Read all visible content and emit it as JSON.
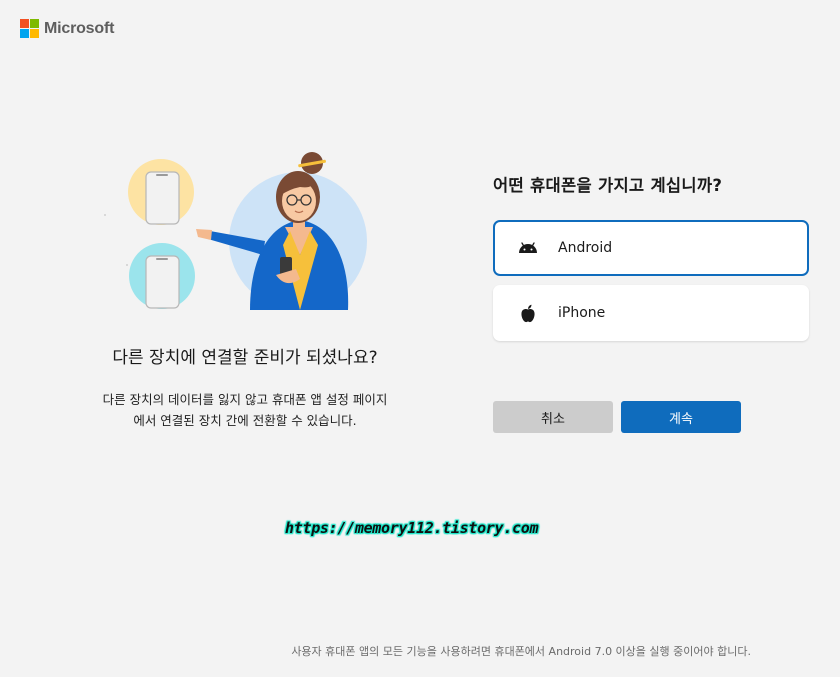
{
  "brand": {
    "name": "Microsoft",
    "colors": [
      "#f25022",
      "#7fba00",
      "#00a4ef",
      "#ffb900"
    ]
  },
  "left": {
    "title": "다른 장치에 연결할 준비가 되셨나요?",
    "description_line1": "다른 장치의 데이터를 잃지 않고 휴대폰 앱 설정 페이지",
    "description_line2": "에서 연결된 장치 간에 전환할 수 있습니다."
  },
  "question": "어떤 휴대폰을 가지고 계십니까?",
  "options": [
    {
      "label": "Android",
      "icon": "android-icon",
      "selected": true
    },
    {
      "label": "iPhone",
      "icon": "apple-icon",
      "selected": false
    }
  ],
  "buttons": {
    "cancel": "취소",
    "continue": "계속"
  },
  "watermark": "https://memory112.tistory.com",
  "footer": "사용자 휴대폰 앱의 모든 기능을 사용하려면 휴대폰에서 Android 7.0 이상을 실행 중이어야 합니다.",
  "colors": {
    "accent": "#0f6cbd",
    "background": "#f3f3f3",
    "cancel_bg": "#cccccc"
  }
}
